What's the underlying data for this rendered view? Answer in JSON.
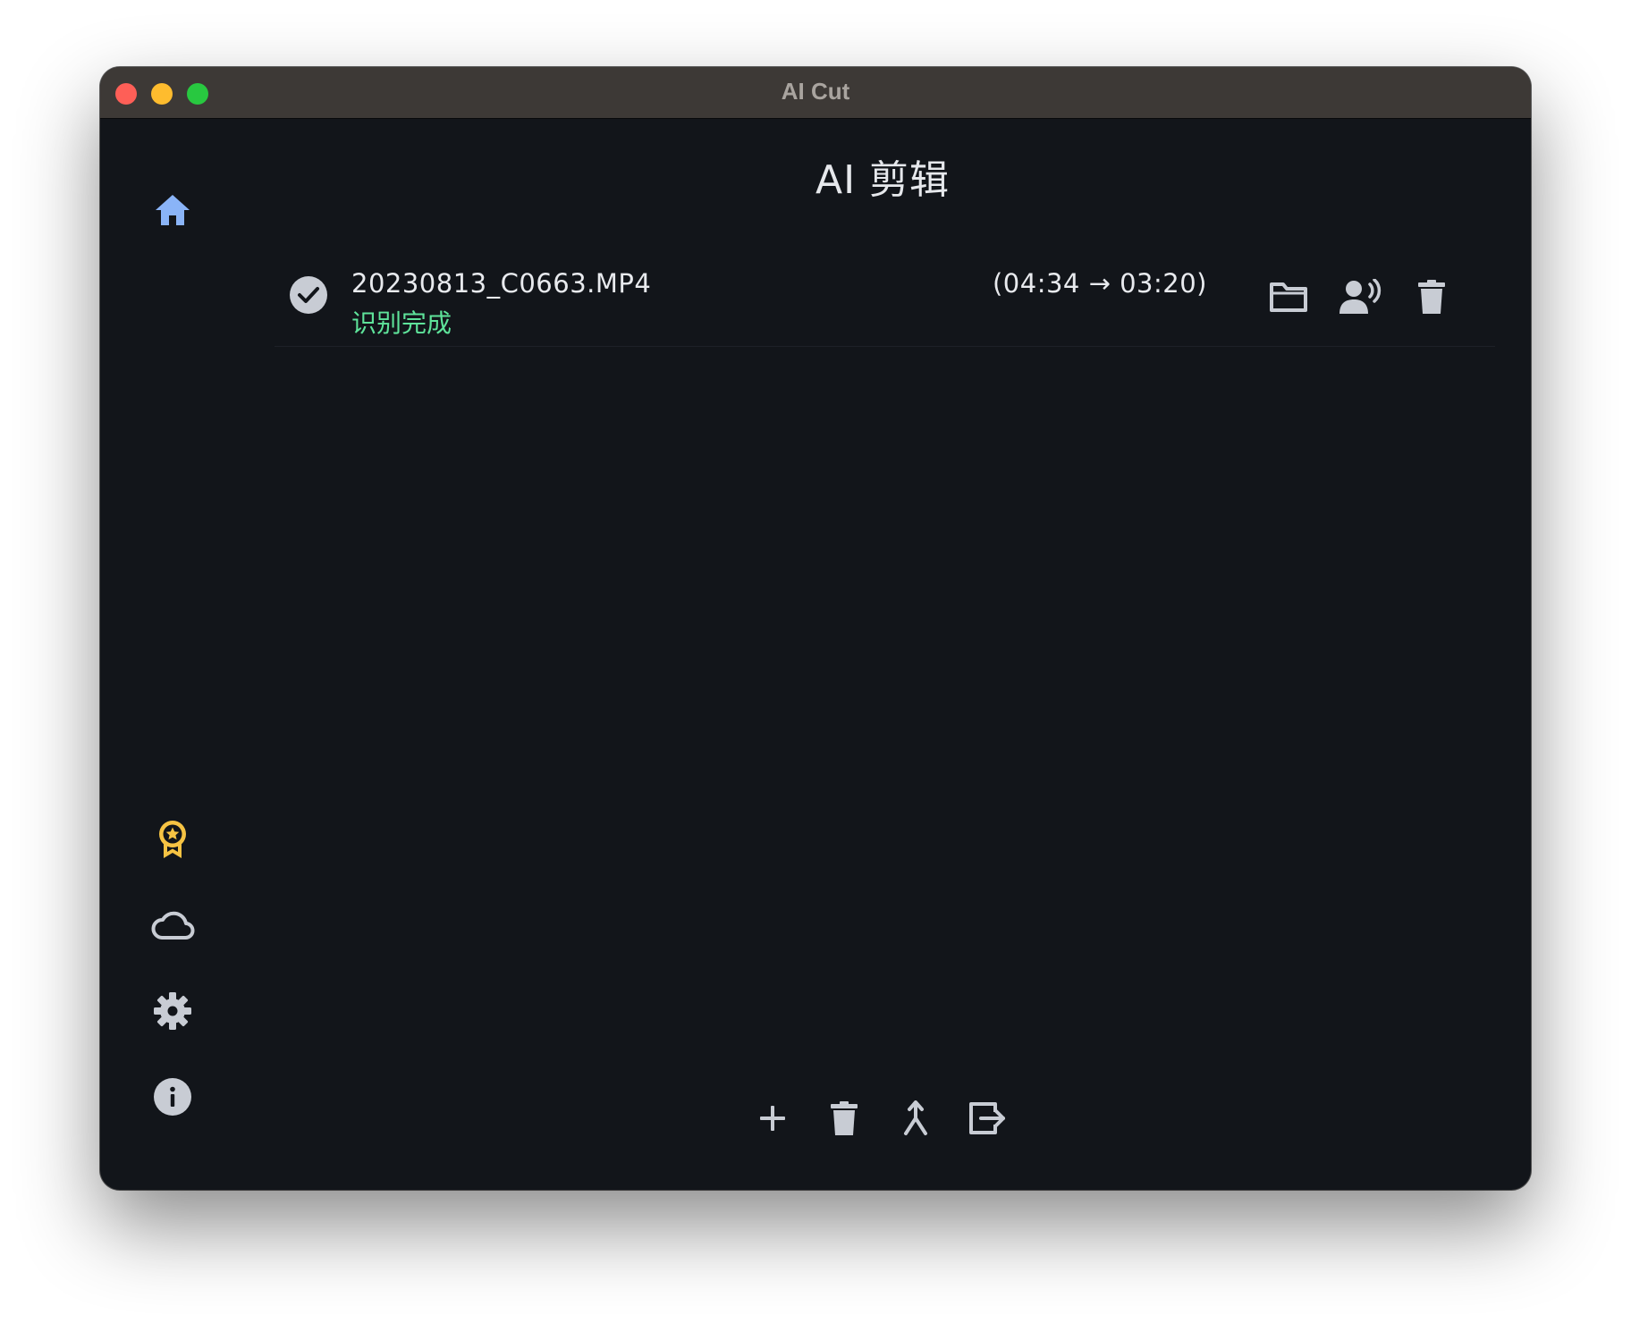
{
  "window": {
    "title": "AI Cut"
  },
  "page": {
    "title": "AI 剪辑"
  },
  "files": [
    {
      "name": "20230813_C0663.MP4",
      "status": "识别完成",
      "duration": "(04:34 → 03:20)"
    }
  ],
  "sidebar": {
    "top": [
      {
        "icon": "home-icon",
        "color": "#8ab4f8"
      }
    ],
    "bottom": [
      {
        "icon": "award-icon",
        "color": "#f6c343"
      },
      {
        "icon": "cloud-icon",
        "color": "#c8ccd4"
      },
      {
        "icon": "gear-icon",
        "color": "#c8ccd4"
      },
      {
        "icon": "info-icon",
        "color": "#c8ccd4"
      }
    ]
  },
  "row_actions": [
    "folder-icon",
    "speaker-icon",
    "trash-icon"
  ],
  "bottom_actions": [
    "plus-icon",
    "trash-icon",
    "merge-icon",
    "export-icon"
  ],
  "colors": {
    "background": "#12151a",
    "titlebar": "#3d3936",
    "status_done": "#5ee39a",
    "accent": "#8ab4f8",
    "icon": "#c8ccd4"
  }
}
